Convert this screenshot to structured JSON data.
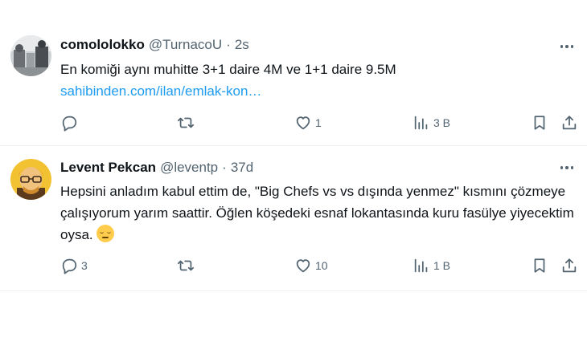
{
  "tweets": [
    {
      "display_name": "comololokko",
      "handle": "@TurnacoU",
      "separator": "·",
      "time": "2s",
      "text": "En komiği aynı muhitte 3+1 daire 4M ve 1+1 daire 9.5M",
      "link": "sahibinden.com/ilan/emlak-kon…",
      "reply_count": "",
      "retweet_count": "",
      "like_count": "1",
      "view_count": "3 B"
    },
    {
      "display_name": "Levent Pekcan",
      "handle": "@leventp",
      "separator": "·",
      "time": "37d",
      "text": "Hepsini anladım kabul ettim de, \"Big Chefs vs vs dışında yenmez\" kısmını çözmeye çalışıyorum yarım saattir. Öğlen köşedeki esnaf lokantasında kuru fasülye yiyecektim oysa.",
      "reply_count": "3",
      "retweet_count": "",
      "like_count": "10",
      "view_count": "1 B"
    }
  ],
  "icons": {
    "more": "more-horizontal-icon",
    "reply": "reply-icon",
    "retweet": "retweet-icon",
    "like": "heart-icon",
    "views": "views-icon",
    "bookmark": "bookmark-icon",
    "share": "share-icon"
  },
  "colors": {
    "text": "#0f1419",
    "secondary": "#536471",
    "link": "#1d9bf0",
    "divider": "#eff3f4"
  }
}
